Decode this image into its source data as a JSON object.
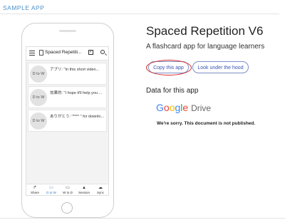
{
  "section_label": "SAMPLE APP",
  "phone": {
    "app_title": "Spaced Repetiti...",
    "cards": [
      {
        "badge": "D to W",
        "text": "アプリ: \"In this short video..."
      },
      {
        "badge": "D to W",
        "text": "効果的: \"I hope it'll help you ..."
      },
      {
        "badge": "D to W",
        "text": "ありがとう: \"**** \" for downlo..."
      }
    ],
    "nav": [
      {
        "label": "Share",
        "icon": "share-icon",
        "glyph": "↱"
      },
      {
        "label": "D to W",
        "icon": "monitor-icon",
        "glyph": "▭"
      },
      {
        "label": "W to D",
        "icon": "monitor-icon",
        "glyph": "▭"
      },
      {
        "label": "Session",
        "icon": "cards-icon",
        "glyph": "▲"
      },
      {
        "label": "Sync",
        "icon": "cloud-sync-icon",
        "glyph": "☁"
      }
    ],
    "active_nav": "D to W",
    "accent_color": "#3a7bc0"
  },
  "app": {
    "name": "Spaced Repetition V6",
    "description": "A flashcard app for language learners",
    "copy_button": "Copy this app",
    "hood_button": "Look under the hood"
  },
  "data_section": {
    "title": "Data for this app",
    "google_letters": [
      "G",
      "o",
      "o",
      "g",
      "l",
      "e"
    ],
    "google_colors": [
      "#4285F4",
      "#EA4335",
      "#FBBC05",
      "#4285F4",
      "#34A853",
      "#EA4335"
    ],
    "drive_word": "Drive",
    "message": "We're sorry. This document is not published."
  },
  "colors": {
    "section_label": "#4a90c8",
    "button_border": "#7d8fc9",
    "highlight_circle": "#d62525"
  }
}
